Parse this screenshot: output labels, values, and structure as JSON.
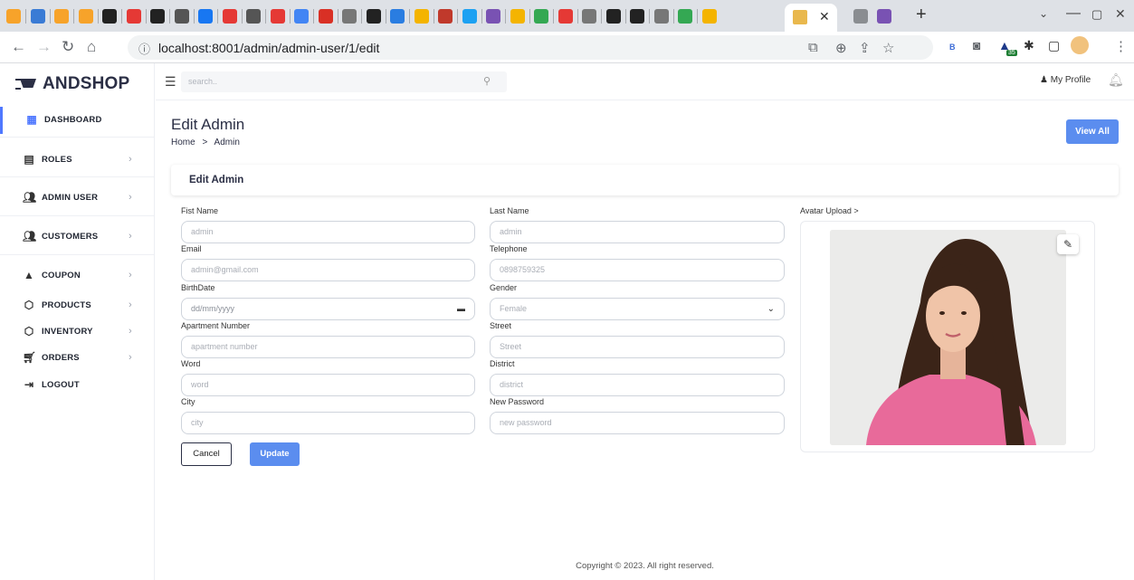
{
  "browser": {
    "url": "localhost:8001/admin/admin-user/1/edit",
    "tab_colors": [
      "#f7a32a",
      "#3a7bd5",
      "#f7a32a",
      "#f7a32a",
      "#222222",
      "#e53935",
      "#222222",
      "#555555",
      "#1877f2",
      "#e53935",
      "#555555",
      "#e53935",
      "#4285f4",
      "#d93025",
      "#777777",
      "#222222",
      "#2a7de1",
      "#f4b400",
      "#c0392b",
      "#1da1f2",
      "#7952b3",
      "#f4b400",
      "#34a853",
      "#e53935",
      "#777777",
      "#222222",
      "#222222",
      "#777777",
      "#34a853",
      "#f4b400"
    ],
    "extension_icons": [
      "translate-icon",
      "zoom-icon",
      "share-icon",
      "star-icon",
      "bookmark-b-icon",
      "camera-icon",
      "extension-35-icon",
      "puzzle-icon",
      "sidepanel-icon",
      "profile-icon",
      "more-icon"
    ],
    "extension_badge": "35"
  },
  "app": {
    "logo": "ANDSHOP",
    "search_placeholder": "search..",
    "profile_label": "My Profile"
  },
  "sidebar": {
    "items": [
      {
        "label": "DASHBOARD",
        "icon": "dashboard-icon",
        "chevron": false
      },
      {
        "label": "ROLES",
        "icon": "roles-icon",
        "chevron": true
      },
      {
        "label": "ADMIN USER",
        "icon": "admin-user-icon",
        "chevron": true
      },
      {
        "label": "CUSTOMERS",
        "icon": "customers-icon",
        "chevron": true
      },
      {
        "label": "COUPON",
        "icon": "coupon-icon",
        "chevron": true
      },
      {
        "label": "PRODUCTS",
        "icon": "products-icon",
        "chevron": true
      },
      {
        "label": "INVENTORY",
        "icon": "inventory-icon",
        "chevron": true
      },
      {
        "label": "ORDERS",
        "icon": "orders-icon",
        "chevron": true
      },
      {
        "label": "LOGOUT",
        "icon": "logout-icon",
        "chevron": false
      }
    ]
  },
  "page": {
    "title": "Edit Admin",
    "breadcrumb_home": "Home",
    "breadcrumb_sep": ">",
    "breadcrumb_current": "Admin",
    "view_all_label": "View All",
    "card_title": "Edit Admin"
  },
  "form": {
    "first_name": {
      "label": "Fist Name",
      "value": "admin"
    },
    "last_name": {
      "label": "Last Name",
      "value": "admin"
    },
    "email": {
      "label": "Email",
      "value": "admin@gmail.com"
    },
    "telephone": {
      "label": "Telephone",
      "value": "0898759325"
    },
    "birthdate": {
      "label": "BirthDate",
      "placeholder": "dd/mm/yyyy"
    },
    "gender": {
      "label": "Gender",
      "value": "Female"
    },
    "apartment": {
      "label": "Apartment Number",
      "placeholder": "apartment number"
    },
    "street": {
      "label": "Street",
      "placeholder": "Street"
    },
    "ward": {
      "label": "Word",
      "placeholder": "word"
    },
    "district": {
      "label": "District",
      "placeholder": "district"
    },
    "city": {
      "label": "City",
      "placeholder": "city"
    },
    "new_password": {
      "label": "New Password",
      "placeholder": "new password"
    },
    "cancel_label": "Cancel",
    "update_label": "Update",
    "avatar_label": "Avatar Upload >"
  },
  "footer": {
    "text": "Copyright © 2023. All right reserved."
  },
  "colors": {
    "accent": "#5b8def",
    "active_border": "#4f78ff",
    "sweater": "#e86a9a",
    "hair": "#3b2418"
  }
}
